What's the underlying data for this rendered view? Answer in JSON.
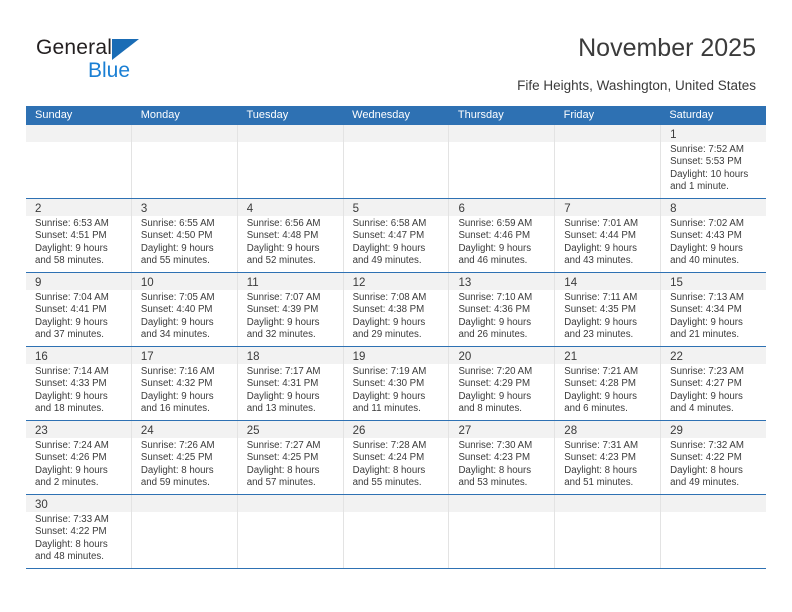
{
  "logo": {
    "text_primary": "General",
    "text_secondary": "Blue",
    "primary_color": "#231f20",
    "secondary_color": "#1a7fd4",
    "triangle_color": "#1a6cb5"
  },
  "header": {
    "title": "November 2025",
    "location": "Fife Heights, Washington, United States"
  },
  "theme": {
    "header_bg": "#2e71b3",
    "header_text": "#ffffff",
    "daynum_band_bg": "#f2f2f2",
    "row_separator": "#2e71b3",
    "body_text": "#3b3b3b"
  },
  "weekdays": [
    "Sunday",
    "Monday",
    "Tuesday",
    "Wednesday",
    "Thursday",
    "Friday",
    "Saturday"
  ],
  "weeks": [
    [
      {
        "day": "",
        "lines": []
      },
      {
        "day": "",
        "lines": []
      },
      {
        "day": "",
        "lines": []
      },
      {
        "day": "",
        "lines": []
      },
      {
        "day": "",
        "lines": []
      },
      {
        "day": "",
        "lines": []
      },
      {
        "day": "1",
        "lines": [
          "Sunrise: 7:52 AM",
          "Sunset: 5:53 PM",
          "Daylight: 10 hours",
          "and 1 minute."
        ]
      }
    ],
    [
      {
        "day": "2",
        "lines": [
          "Sunrise: 6:53 AM",
          "Sunset: 4:51 PM",
          "Daylight: 9 hours",
          "and 58 minutes."
        ]
      },
      {
        "day": "3",
        "lines": [
          "Sunrise: 6:55 AM",
          "Sunset: 4:50 PM",
          "Daylight: 9 hours",
          "and 55 minutes."
        ]
      },
      {
        "day": "4",
        "lines": [
          "Sunrise: 6:56 AM",
          "Sunset: 4:48 PM",
          "Daylight: 9 hours",
          "and 52 minutes."
        ]
      },
      {
        "day": "5",
        "lines": [
          "Sunrise: 6:58 AM",
          "Sunset: 4:47 PM",
          "Daylight: 9 hours",
          "and 49 minutes."
        ]
      },
      {
        "day": "6",
        "lines": [
          "Sunrise: 6:59 AM",
          "Sunset: 4:46 PM",
          "Daylight: 9 hours",
          "and 46 minutes."
        ]
      },
      {
        "day": "7",
        "lines": [
          "Sunrise: 7:01 AM",
          "Sunset: 4:44 PM",
          "Daylight: 9 hours",
          "and 43 minutes."
        ]
      },
      {
        "day": "8",
        "lines": [
          "Sunrise: 7:02 AM",
          "Sunset: 4:43 PM",
          "Daylight: 9 hours",
          "and 40 minutes."
        ]
      }
    ],
    [
      {
        "day": "9",
        "lines": [
          "Sunrise: 7:04 AM",
          "Sunset: 4:41 PM",
          "Daylight: 9 hours",
          "and 37 minutes."
        ]
      },
      {
        "day": "10",
        "lines": [
          "Sunrise: 7:05 AM",
          "Sunset: 4:40 PM",
          "Daylight: 9 hours",
          "and 34 minutes."
        ]
      },
      {
        "day": "11",
        "lines": [
          "Sunrise: 7:07 AM",
          "Sunset: 4:39 PM",
          "Daylight: 9 hours",
          "and 32 minutes."
        ]
      },
      {
        "day": "12",
        "lines": [
          "Sunrise: 7:08 AM",
          "Sunset: 4:38 PM",
          "Daylight: 9 hours",
          "and 29 minutes."
        ]
      },
      {
        "day": "13",
        "lines": [
          "Sunrise: 7:10 AM",
          "Sunset: 4:36 PM",
          "Daylight: 9 hours",
          "and 26 minutes."
        ]
      },
      {
        "day": "14",
        "lines": [
          "Sunrise: 7:11 AM",
          "Sunset: 4:35 PM",
          "Daylight: 9 hours",
          "and 23 minutes."
        ]
      },
      {
        "day": "15",
        "lines": [
          "Sunrise: 7:13 AM",
          "Sunset: 4:34 PM",
          "Daylight: 9 hours",
          "and 21 minutes."
        ]
      }
    ],
    [
      {
        "day": "16",
        "lines": [
          "Sunrise: 7:14 AM",
          "Sunset: 4:33 PM",
          "Daylight: 9 hours",
          "and 18 minutes."
        ]
      },
      {
        "day": "17",
        "lines": [
          "Sunrise: 7:16 AM",
          "Sunset: 4:32 PM",
          "Daylight: 9 hours",
          "and 16 minutes."
        ]
      },
      {
        "day": "18",
        "lines": [
          "Sunrise: 7:17 AM",
          "Sunset: 4:31 PM",
          "Daylight: 9 hours",
          "and 13 minutes."
        ]
      },
      {
        "day": "19",
        "lines": [
          "Sunrise: 7:19 AM",
          "Sunset: 4:30 PM",
          "Daylight: 9 hours",
          "and 11 minutes."
        ]
      },
      {
        "day": "20",
        "lines": [
          "Sunrise: 7:20 AM",
          "Sunset: 4:29 PM",
          "Daylight: 9 hours",
          "and 8 minutes."
        ]
      },
      {
        "day": "21",
        "lines": [
          "Sunrise: 7:21 AM",
          "Sunset: 4:28 PM",
          "Daylight: 9 hours",
          "and 6 minutes."
        ]
      },
      {
        "day": "22",
        "lines": [
          "Sunrise: 7:23 AM",
          "Sunset: 4:27 PM",
          "Daylight: 9 hours",
          "and 4 minutes."
        ]
      }
    ],
    [
      {
        "day": "23",
        "lines": [
          "Sunrise: 7:24 AM",
          "Sunset: 4:26 PM",
          "Daylight: 9 hours",
          "and 2 minutes."
        ]
      },
      {
        "day": "24",
        "lines": [
          "Sunrise: 7:26 AM",
          "Sunset: 4:25 PM",
          "Daylight: 8 hours",
          "and 59 minutes."
        ]
      },
      {
        "day": "25",
        "lines": [
          "Sunrise: 7:27 AM",
          "Sunset: 4:25 PM",
          "Daylight: 8 hours",
          "and 57 minutes."
        ]
      },
      {
        "day": "26",
        "lines": [
          "Sunrise: 7:28 AM",
          "Sunset: 4:24 PM",
          "Daylight: 8 hours",
          "and 55 minutes."
        ]
      },
      {
        "day": "27",
        "lines": [
          "Sunrise: 7:30 AM",
          "Sunset: 4:23 PM",
          "Daylight: 8 hours",
          "and 53 minutes."
        ]
      },
      {
        "day": "28",
        "lines": [
          "Sunrise: 7:31 AM",
          "Sunset: 4:23 PM",
          "Daylight: 8 hours",
          "and 51 minutes."
        ]
      },
      {
        "day": "29",
        "lines": [
          "Sunrise: 7:32 AM",
          "Sunset: 4:22 PM",
          "Daylight: 8 hours",
          "and 49 minutes."
        ]
      }
    ],
    [
      {
        "day": "30",
        "lines": [
          "Sunrise: 7:33 AM",
          "Sunset: 4:22 PM",
          "Daylight: 8 hours",
          "and 48 minutes."
        ]
      },
      {
        "day": "",
        "lines": []
      },
      {
        "day": "",
        "lines": []
      },
      {
        "day": "",
        "lines": []
      },
      {
        "day": "",
        "lines": []
      },
      {
        "day": "",
        "lines": []
      },
      {
        "day": "",
        "lines": []
      }
    ]
  ]
}
